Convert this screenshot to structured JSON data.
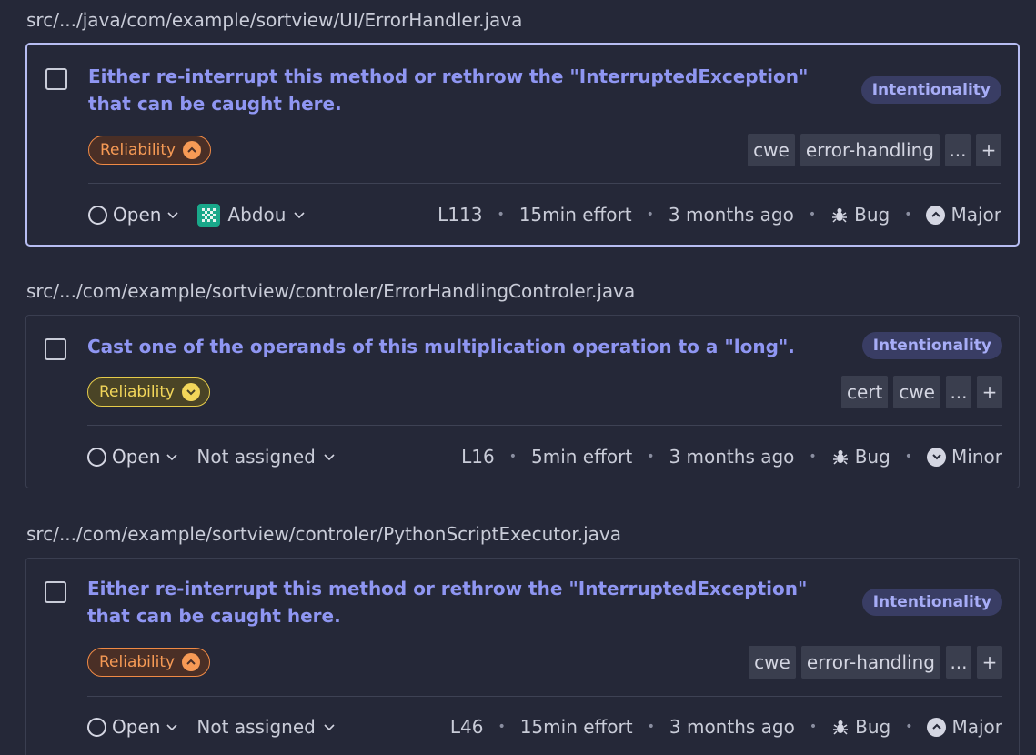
{
  "issues": [
    {
      "file_path": "src/.../java/com/example/sortview/UI/ErrorHandler.java",
      "title": "Either re-interrupt this method or rethrow the \"InterruptedException\" that can be caught here.",
      "badge": "Intentionality",
      "quality": "Reliability",
      "quality_level": "high",
      "tags": [
        "cwe",
        "error-handling",
        "...",
        "+"
      ],
      "status": "Open",
      "assignee": "Abdou",
      "line": "L113",
      "effort": "15min effort",
      "age": "3 months ago",
      "type": "Bug",
      "severity": "Major"
    },
    {
      "file_path": "src/.../com/example/sortview/controler/ErrorHandlingControler.java",
      "title": "Cast one of the operands of this multiplication operation to a \"long\".",
      "badge": "Intentionality",
      "quality": "Reliability",
      "quality_level": "medium",
      "tags": [
        "cert",
        "cwe",
        "...",
        "+"
      ],
      "status": "Open",
      "assignee": "Not assigned",
      "line": "L16",
      "effort": "5min effort",
      "age": "3 months ago",
      "type": "Bug",
      "severity": "Minor"
    },
    {
      "file_path": "src/.../com/example/sortview/controler/PythonScriptExecutor.java",
      "title": "Either re-interrupt this method or rethrow the \"InterruptedException\" that can be caught here.",
      "badge": "Intentionality",
      "quality": "Reliability",
      "quality_level": "high",
      "tags": [
        "cwe",
        "error-handling",
        "...",
        "+"
      ],
      "status": "Open",
      "assignee": "Not assigned",
      "line": "L46",
      "effort": "15min effort",
      "age": "3 months ago",
      "type": "Bug",
      "severity": "Major"
    }
  ],
  "colors": {
    "background": "#252838",
    "title": "#8f96f2",
    "selected_border": "#b7bdf2",
    "high_impact": "#f69a55",
    "medium_impact": "#f2d65a",
    "intent_badge_bg": "#393d64"
  },
  "icons": {
    "status": "circle-icon",
    "dropdown": "chevron-down-icon",
    "avatar": "identicon-avatar",
    "type": "bug-icon",
    "severity_major": "chevron-up-circle-icon",
    "severity_minor": "chevron-down-circle-icon"
  }
}
